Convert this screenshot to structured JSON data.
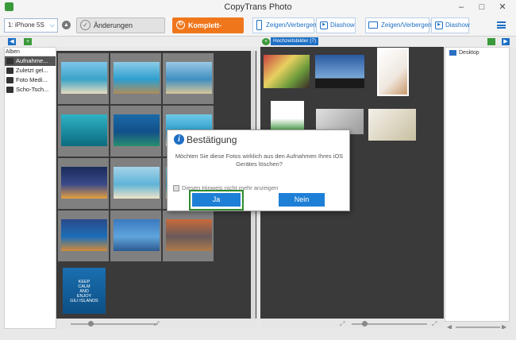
{
  "window": {
    "title": "CopyTrans Photo",
    "minimize": "–",
    "maximize": "□",
    "close": "✕"
  },
  "toolbar": {
    "device": "1: iPhone 5S",
    "save_label": "Änderungen speichern",
    "backup_label": "Komplett-Backup",
    "show_hide_label": "Zeigen/Verbergen",
    "slideshow_label": "Diashow",
    "show_hide_label_2": "Zeigen/Verbergen",
    "slideshow_label_2": "Diashow"
  },
  "albums": {
    "header": "Alben",
    "items": [
      {
        "label": "Aufnahme...",
        "icon": "camera-roll-icon"
      },
      {
        "label": "Zuletzt gel...",
        "icon": "trash-icon"
      },
      {
        "label": "Foto Medi...",
        "icon": "camera-icon"
      },
      {
        "label": "Scho-Tsch...",
        "icon": "album-icon"
      }
    ]
  },
  "pc_panel": {
    "album_tag": "Hochzeitsbilder (7)"
  },
  "device_panel": {
    "folder": "Desktop"
  },
  "grid1_photos": [
    {
      "colors": [
        "#7cc6ea",
        "#3aa4c7",
        "#e8dcc0"
      ],
      "icon": "beach-photo"
    },
    {
      "colors": [
        "#8ccbe8",
        "#2e9fcf",
        "#b08c5a"
      ],
      "icon": "overwater-bungalow-photo"
    },
    {
      "colors": [
        "#9ac7e6",
        "#3f8fc0",
        "#d9c79a"
      ],
      "icon": "beach-photo"
    },
    {
      "colors": [
        "#2fb3c4",
        "#1a8aa0",
        "#0d6b7d"
      ],
      "icon": "underwater-photo"
    },
    {
      "colors": [
        "#1b6aa8",
        "#12508a",
        "#2a8f6f"
      ],
      "icon": "turtle-photo"
    },
    {
      "colors": [
        "#6ec8e8",
        "#2d9fcc",
        "#e9e2cc"
      ],
      "icon": "beach-photo"
    },
    {
      "colors": [
        "#1a2b5a",
        "#3a4a8a",
        "#e7a040"
      ],
      "icon": "resort-night-photo"
    },
    {
      "colors": [
        "#a6d3ea",
        "#5fb4d8",
        "#efe4c8"
      ],
      "icon": "beach-photo"
    },
    {
      "colors": [
        "#8ec7e4",
        "#3b9fc9",
        "#d8c8a0"
      ],
      "icon": "beach-photo"
    },
    {
      "colors": [
        "#2a4a8a",
        "#1d6fb8",
        "#d28a3a"
      ],
      "icon": "sunset-photo"
    },
    {
      "colors": [
        "#3a7ac0",
        "#5fa5dc",
        "#2c5a90"
      ],
      "icon": "panorama-photo"
    },
    {
      "colors": [
        "#c86a3a",
        "#6a5a5a",
        "#b07a4a"
      ],
      "icon": "beach-huts-photo"
    }
  ],
  "poster": {
    "line1": "KEEP",
    "line2": "CALM",
    "line3": "AND",
    "line4": "ENJOY",
    "line5": "GILI ISLANDS"
  },
  "dialog": {
    "title": "Bestätigung",
    "message": "Möchten Sie diese Fotos wirklich aus den Aufnahmen Ihres iOS Gerätes löschen?",
    "checkbox_label": "Diesen Hinweis nicht mehr anzeigen",
    "yes_label": "Ja",
    "no_label": "Nein"
  },
  "colors": {
    "accent": "#1d6fc4",
    "backup": "#f0761b",
    "highlight": "#2e8b2e"
  }
}
